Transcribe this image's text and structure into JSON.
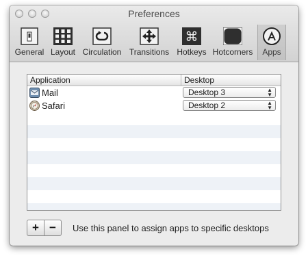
{
  "window": {
    "title": "Preferences"
  },
  "toolbar": {
    "items": [
      {
        "label": "General",
        "icon": "switch-icon"
      },
      {
        "label": "Layout",
        "icon": "grid-icon"
      },
      {
        "label": "Circulation",
        "icon": "circulation-icon"
      },
      {
        "label": "Transitions",
        "icon": "move-arrows-icon"
      },
      {
        "label": "Hotkeys",
        "icon": "command-key-icon"
      },
      {
        "label": "Hotcorners",
        "icon": "hotcorners-icon"
      },
      {
        "label": "Apps",
        "icon": "app-store-icon",
        "selected": true
      }
    ]
  },
  "table": {
    "columns": {
      "application": "Application",
      "desktop": "Desktop"
    },
    "rows": [
      {
        "app": "Mail",
        "icon": "mail-app-icon",
        "desktop": "Desktop 3"
      },
      {
        "app": "Safari",
        "icon": "safari-app-icon",
        "desktop": "Desktop 2"
      }
    ]
  },
  "footer": {
    "add_label": "+",
    "remove_label": "−",
    "hint": "Use this panel to assign apps to specific desktops"
  }
}
